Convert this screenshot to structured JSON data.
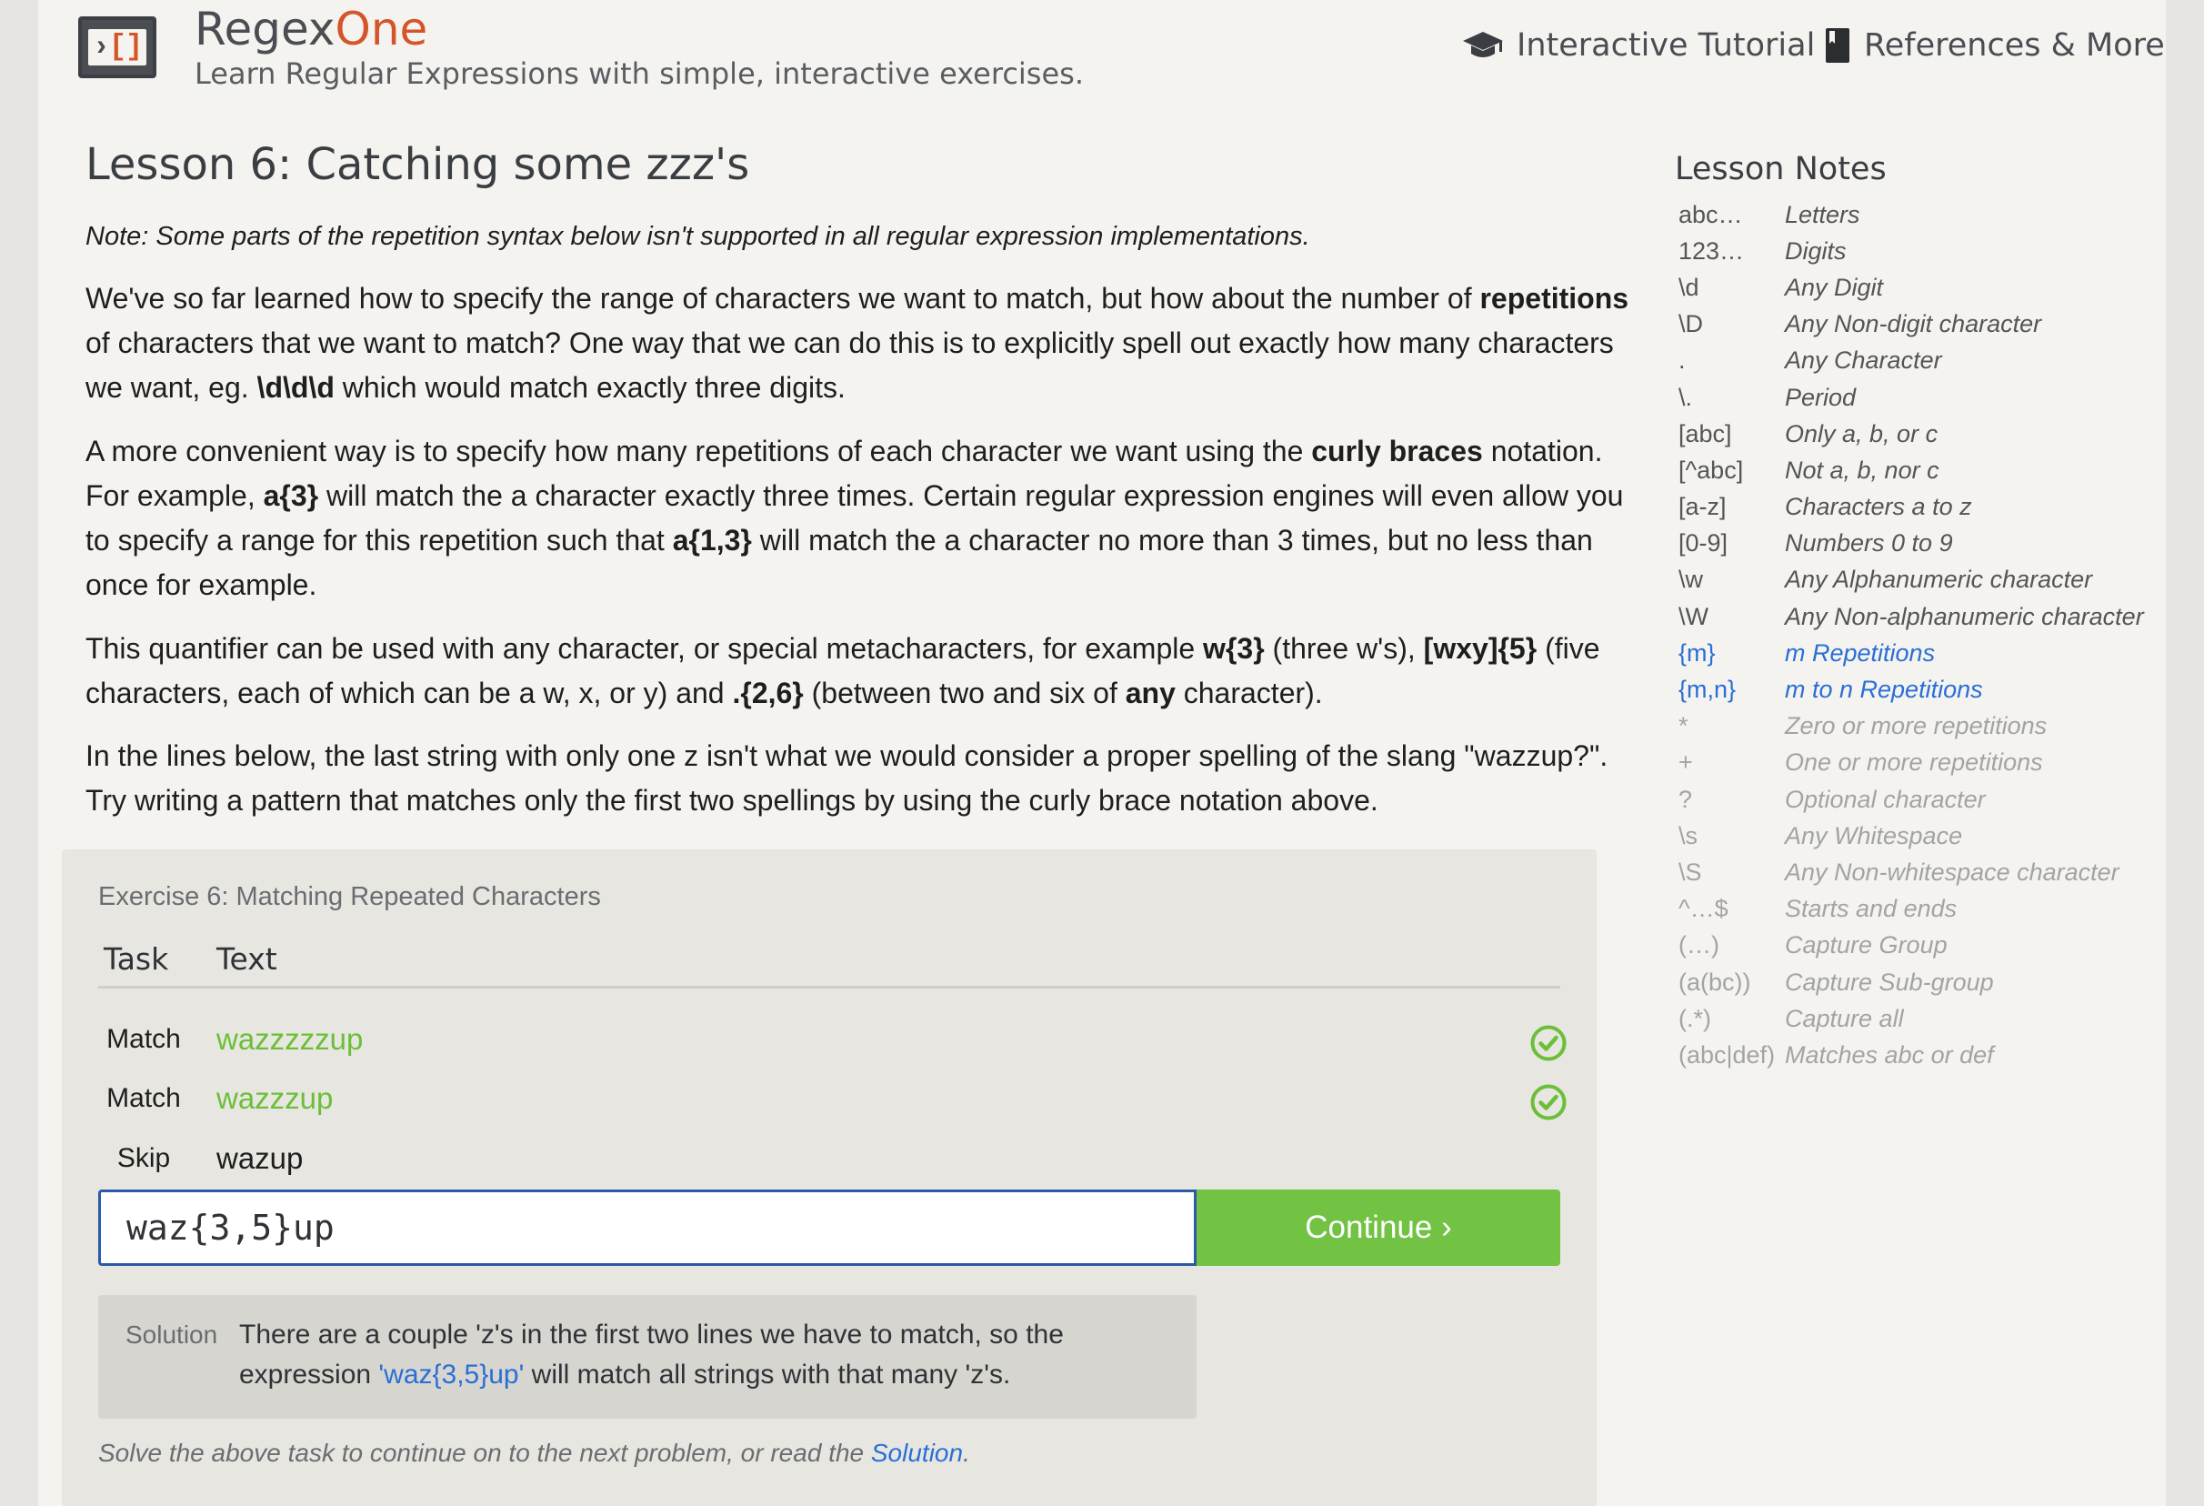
{
  "header": {
    "brand_regex": "Regex",
    "brand_one": "One",
    "tagline": "Learn Regular Expressions with simple, interactive exercises.",
    "nav": [
      {
        "label": "Interactive Tutorial",
        "icon": "graduation-cap-icon"
      },
      {
        "label": "References & More",
        "icon": "book-icon"
      }
    ]
  },
  "lesson": {
    "title": "Lesson 6: Catching some zzz's",
    "note": "Note: Some parts of the repetition syntax below isn't supported in all regular expression implementations.",
    "p1": {
      "t1": "We've so far learned how to specify the range of characters we want to match, but how about the number of ",
      "b1": "repetitions",
      "t2": " of characters that we want to match? One way that we can do this is to explicitly spell out exactly how many characters we want, eg. ",
      "b2": "\\d\\d\\d",
      "t3": " which would match exactly three digits."
    },
    "p2": {
      "t1": "A more convenient way is to specify how many repetitions of each character we want using the ",
      "b1": "curly braces",
      "t2": " notation. For example, ",
      "b2": "a{3}",
      "t3": " will match the a character exactly three times. Certain regular expression engines will even allow you to specify a range for this repetition such that ",
      "b3": "a{1,3}",
      "t4": " will match the a character no more than 3 times, but no less than once for example."
    },
    "p3": {
      "t1": "This quantifier can be used with any character, or special metacharacters, for example ",
      "b1": "w{3}",
      "t2": " (three w's), ",
      "b2": "[wxy]{5}",
      "t3": " (five characters, each of which can be a w, x, or y) and ",
      "b3": ".{2,6}",
      "t4": " (between two and six of ",
      "b4": "any",
      "t5": " character)."
    },
    "p4": "In the lines below, the last string with only one z isn't what we would consider a proper spelling of the slang \"wazzup?\". Try writing a pattern that matches only the first two spellings by using the curly brace notation above."
  },
  "exercise": {
    "title": "Exercise 6: Matching Repeated Characters",
    "columns": [
      "Task",
      "Text"
    ],
    "rows": [
      {
        "task": "Match",
        "text": "wazzzzzup",
        "status": "matched"
      },
      {
        "task": "Match",
        "text": "wazzzup",
        "status": "matched"
      },
      {
        "task": "Skip",
        "text": "wazup",
        "status": "none"
      }
    ],
    "input_value": "waz{3,5}up",
    "continue_label": "Continue ›",
    "solution_label": "Solution",
    "solution": {
      "t1": "There are a couple 'z's in the first two lines we have to match, so the expression ",
      "code": "'waz{3,5}up'",
      "t2": " will match all strings with that many 'z's."
    },
    "footer": {
      "t1": "Solve the above task to continue on to the next problem, or read the ",
      "link": "Solution",
      "t2": "."
    }
  },
  "notes": {
    "title": "Lesson Notes",
    "items": [
      {
        "code": "abc…",
        "desc": "Letters",
        "state": "normal"
      },
      {
        "code": "123…",
        "desc": "Digits",
        "state": "normal"
      },
      {
        "code": "\\d",
        "desc": "Any Digit",
        "state": "normal"
      },
      {
        "code": "\\D",
        "desc": "Any Non-digit character",
        "state": "normal"
      },
      {
        "code": ".",
        "desc": "Any Character",
        "state": "normal"
      },
      {
        "code": "\\.",
        "desc": "Period",
        "state": "normal"
      },
      {
        "code": "[abc]",
        "desc": "Only a, b, or c",
        "state": "normal"
      },
      {
        "code": "[^abc]",
        "desc": "Not a, b, nor c",
        "state": "normal"
      },
      {
        "code": "[a-z]",
        "desc": "Characters a to z",
        "state": "normal"
      },
      {
        "code": "[0-9]",
        "desc": "Numbers 0 to 9",
        "state": "normal"
      },
      {
        "code": "\\w",
        "desc": "Any Alphanumeric character",
        "state": "normal"
      },
      {
        "code": "\\W",
        "desc": "Any Non-alphanumeric character",
        "state": "normal"
      },
      {
        "code": "{m}",
        "desc": "m Repetitions",
        "state": "active"
      },
      {
        "code": "{m,n}",
        "desc": "m to n Repetitions",
        "state": "active"
      },
      {
        "code": "*",
        "desc": "Zero or more repetitions",
        "state": "faded"
      },
      {
        "code": "+",
        "desc": "One or more repetitions",
        "state": "faded"
      },
      {
        "code": "?",
        "desc": "Optional character",
        "state": "faded"
      },
      {
        "code": "\\s",
        "desc": "Any Whitespace",
        "state": "faded"
      },
      {
        "code": "\\S",
        "desc": "Any Non-whitespace character",
        "state": "faded"
      },
      {
        "code": "^…$",
        "desc": "Starts and ends",
        "state": "faded"
      },
      {
        "code": "(…)",
        "desc": "Capture Group",
        "state": "faded"
      },
      {
        "code": "(a(bc))",
        "desc": "Capture Sub-group",
        "state": "faded"
      },
      {
        "code": "(.*)",
        "desc": "Capture all",
        "state": "faded"
      },
      {
        "code": "(abc|def)",
        "desc": "Matches abc or def",
        "state": "faded"
      }
    ]
  },
  "colors": {
    "accent_orange": "#d4552a",
    "success_green": "#72c244",
    "link_blue": "#2a6fd6",
    "input_border": "#2b5aa8"
  }
}
